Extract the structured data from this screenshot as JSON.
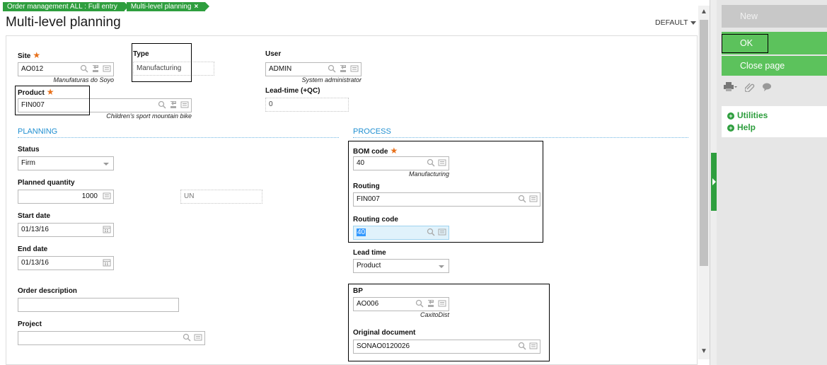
{
  "breadcrumbs": [
    "Order management ALL : Full entry",
    "Multi-level planning"
  ],
  "breadcrumb_close": "×",
  "page_title": "Multi-level planning",
  "default_menu": "DEFAULT",
  "req_mark": "★",
  "fields": {
    "site": {
      "label": "Site",
      "value": "AO012",
      "subtitle": "Manufaturas do Soyo"
    },
    "type": {
      "label": "Type",
      "value": "Manufacturing"
    },
    "user": {
      "label": "User",
      "value": "ADMIN",
      "subtitle": "System administrator"
    },
    "product": {
      "label": "Product",
      "value": "FIN007",
      "subtitle": "Children's sport mountain bike"
    },
    "lead_time_qc": {
      "label": "Lead-time (+QC)",
      "value": "0"
    }
  },
  "planning": {
    "title": "PLANNING",
    "status": {
      "label": "Status",
      "value": "Firm"
    },
    "planned_quantity": {
      "label": "Planned quantity",
      "value": "1000",
      "unit": "UN"
    },
    "start_date": {
      "label": "Start date",
      "value": "01/13/16"
    },
    "end_date": {
      "label": "End date",
      "value": "01/13/16"
    },
    "order_description": {
      "label": "Order description",
      "value": ""
    },
    "project": {
      "label": "Project",
      "value": ""
    }
  },
  "process": {
    "title": "PROCESS",
    "bom_code": {
      "label": "BOM code",
      "value": "40",
      "subtitle": "Manufacturing"
    },
    "routing": {
      "label": "Routing",
      "value": "FIN007"
    },
    "routing_code": {
      "label": "Routing code",
      "value": "40"
    },
    "lead_time": {
      "label": "Lead time",
      "value": "Product"
    },
    "bp": {
      "label": "BP",
      "value": "AO006",
      "subtitle": "CaxitoDist"
    },
    "original_document": {
      "label": "Original document",
      "value": "SONAO0120026"
    }
  },
  "right_panel": {
    "new_label": "New",
    "ok_label": "OK",
    "close_label": "Close page",
    "links": [
      "Utilities",
      "Help"
    ]
  },
  "colors": {
    "accent_green": "#2e9e3e",
    "button_green": "#5cc25c",
    "section_blue": "#1f8fd1",
    "required_orange": "#e8701a"
  }
}
